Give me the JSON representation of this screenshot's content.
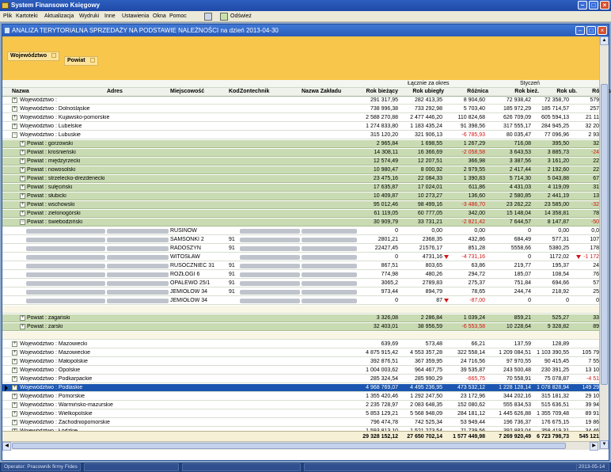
{
  "app": {
    "title": "System Finansowo Księgowy"
  },
  "menu": [
    "Plik",
    "Kartoteki",
    "Aktualizacja",
    "Wydruki",
    "Inne",
    "Ustawienia",
    "Okna",
    "Pomoc"
  ],
  "toolbar": {
    "refresh_label": "Odśwież"
  },
  "report": {
    "title": "ANALIZA TERYTORIALNA SPRZEDAŻY NA PODSTAWIE NALEŻNOŚCI na dzień 2013-04-30"
  },
  "grouping": {
    "chip1": "Województwo",
    "chip2": "Powiat"
  },
  "headers": {
    "band1": "Łącznie za okres",
    "band2": "Styczeń",
    "cols": [
      "Nazwa",
      "Adres",
      "Miejscowość",
      "Kod",
      "Zontechnik",
      "Nazwa Zakładu",
      "Rok bieżący",
      "Rok ubiegły",
      "Różnica",
      "Rok bież.",
      "Rok ub.",
      "Różnica"
    ]
  },
  "rows": [
    {
      "type": "w",
      "name": "Województwo :",
      "v": [
        "291 317,95",
        "282 413,35",
        "8 904,60",
        "72 938,42",
        "72 358,70",
        "579"
      ]
    },
    {
      "type": "w",
      "name": "Województwo : Dolnośląskie",
      "v": [
        "738 996,38",
        "733 292,98",
        "5 703,40",
        "185 972,29",
        "185 714,57",
        "257"
      ]
    },
    {
      "type": "w",
      "name": "Województwo : Kujawsko-pomorskie",
      "v": [
        "2 588 270,88",
        "2 477 446,20",
        "110 824,68",
        "626 709,09",
        "605 594,13",
        "21 11"
      ]
    },
    {
      "type": "w",
      "name": "Województwo : Lubelskie",
      "v": [
        "1 274 833,80",
        "1 183 435,24",
        "91 398,56",
        "317 555,17",
        "284 945,25",
        "32 20"
      ]
    },
    {
      "type": "w",
      "name": "Województwo : Lubuskie",
      "expanded": true,
      "v": [
        "315 120,20",
        "321 906,13",
        "-6 785,93",
        "80 035,47",
        "77 096,96",
        "2 93"
      ]
    },
    {
      "type": "p",
      "name": "Powiat : gorzowski",
      "v": [
        "2 965,84",
        "1 698,55",
        "1 267,29",
        "716,08",
        "395,50",
        "32"
      ]
    },
    {
      "type": "p",
      "name": "Powiat : krośnieński",
      "v": [
        "14 308,11",
        "16 366,69",
        "-2 058,58",
        "3 643,53",
        "3 885,73",
        "-24"
      ]
    },
    {
      "type": "p",
      "name": "Powiat : międzyrzecki",
      "v": [
        "12 574,49",
        "12 207,51",
        "366,98",
        "3 387,56",
        "3 161,20",
        "22"
      ]
    },
    {
      "type": "p",
      "name": "Powiat : nowosolski",
      "v": [
        "10 980,47",
        "8 000,92",
        "2 979,55",
        "2 417,44",
        "2 192,60",
        "22"
      ]
    },
    {
      "type": "p",
      "name": "Powiat : strzelecko-drezdenecki",
      "v": [
        "23 475,16",
        "22 084,33",
        "1 390,83",
        "5 714,30",
        "5 043,88",
        "67"
      ]
    },
    {
      "type": "p",
      "name": "Powiat : sulęciński",
      "v": [
        "17 635,87",
        "17 024,01",
        "611,86",
        "4 431,03",
        "4 119,09",
        "31"
      ]
    },
    {
      "type": "p",
      "name": "Powiat : słubicki",
      "v": [
        "10 409,87",
        "10 273,27",
        "136,60",
        "2 580,85",
        "2 441,19",
        "13"
      ]
    },
    {
      "type": "p",
      "name": "Powiat : wschowski",
      "v": [
        "95 012,46",
        "98 499,16",
        "-3 486,70",
        "23 262,22",
        "23 585,00",
        "-32"
      ]
    },
    {
      "type": "p",
      "name": "Powiat : zielonogórski",
      "v": [
        "61 119,05",
        "60 777,05",
        "342,00",
        "15 148,04",
        "14 358,81",
        "78"
      ]
    },
    {
      "type": "p",
      "name": "Powiat : świebodziński",
      "expanded": true,
      "v": [
        "30 909,79",
        "33 731,21",
        "-2 821,42",
        "7 644,57",
        "8 147,87",
        "-50"
      ]
    },
    {
      "type": "d",
      "city": "RUSINÓW",
      "kod": "",
      "v": [
        "0",
        "0,00",
        "0,00",
        "0",
        "0,00",
        "0,0"
      ]
    },
    {
      "type": "d",
      "city": "SAMSONKI 2",
      "kod": "91",
      "v": [
        "2801,21",
        "2368,35",
        "432,86",
        "684,49",
        "577,31",
        "107"
      ]
    },
    {
      "type": "d",
      "city": "RADOSZYN",
      "kod": "91",
      "v": [
        "22427,45",
        "21576,17",
        "851,28",
        "5558,66",
        "5380,25",
        "178"
      ]
    },
    {
      "type": "d",
      "city": "WITOSŁAW",
      "kod": "",
      "v": [
        "0",
        "4731,16",
        "-4 731,16",
        "0",
        "1172,02",
        "-1 172"
      ],
      "tri": [
        7,
        10
      ]
    },
    {
      "type": "d",
      "city": "RUSOCZNIEC 31",
      "kod": "91",
      "v": [
        "867,51",
        "803,65",
        "63,86",
        "219,77",
        "195,37",
        "24"
      ]
    },
    {
      "type": "d",
      "city": "ROZŁOGI 6",
      "kod": "91",
      "v": [
        "774,98",
        "480,26",
        "294,72",
        "185,07",
        "108,54",
        "76"
      ]
    },
    {
      "type": "d",
      "city": "OPALEWO 25/1",
      "kod": "91",
      "v": [
        "3065,2",
        "2789,83",
        "275,37",
        "751,84",
        "694,66",
        "57"
      ]
    },
    {
      "type": "d",
      "city": "JEMIOŁÓW 34",
      "kod": "91",
      "v": [
        "973,44",
        "894,79",
        "78,65",
        "244,74",
        "218,92",
        "25"
      ]
    },
    {
      "type": "d",
      "city": "JEMIOŁÓW 34",
      "kod": "",
      "v": [
        "0",
        "87",
        "-87,00",
        "0",
        "0",
        "0"
      ],
      "tri": [
        7
      ]
    },
    {
      "type": "b"
    },
    {
      "type": "p",
      "name": "Powiat : żagański",
      "v": [
        "3 326,08",
        "2 286,84",
        "1 039,24",
        "859,21",
        "525,27",
        "33"
      ]
    },
    {
      "type": "p",
      "name": "Powiat : żarski",
      "v": [
        "32 403,01",
        "38 956,59",
        "-6 553,58",
        "10 228,64",
        "9 328,82",
        "89"
      ]
    },
    {
      "type": "b"
    },
    {
      "type": "w",
      "name": "Województwo : Mazowiecki",
      "v": [
        "639,69",
        "573,48",
        "66,21",
        "137,59",
        "128,89",
        ""
      ]
    },
    {
      "type": "w",
      "name": "Województwo : Mazowieckie",
      "v": [
        "4 875 915,42",
        "4 553 357,28",
        "322 558,14",
        "1 209 084,51",
        "1 103 390,55",
        "105 79"
      ]
    },
    {
      "type": "w",
      "name": "Województwo : Małopolskie",
      "v": [
        "392 876,51",
        "367 359,95",
        "24 716,56",
        "97 970,55",
        "90 415,45",
        "7 55"
      ]
    },
    {
      "type": "w",
      "name": "Województwo : Opolskie",
      "v": [
        "1 004 003,62",
        "964 467,75",
        "39 535,87",
        "243 500,48",
        "230 391,25",
        "13 10"
      ]
    },
    {
      "type": "w",
      "name": "Województwo : Podkarpackie",
      "v": [
        "285 324,54",
        "285 990,29",
        "-665,75",
        "70 558,91",
        "75 078,87",
        "-4 51"
      ]
    },
    {
      "type": "w",
      "name": "Województwo : Podlaskie",
      "sel": true,
      "v": [
        "4 968 769,07",
        "4 495 236,95",
        "473 532,12",
        "1 228 128,14",
        "1 078 828,94",
        "149 29"
      ]
    },
    {
      "type": "w",
      "name": "Województwo : Pomorskie",
      "v": [
        "1 355 420,46",
        "1 292 247,50",
        "23 172,96",
        "344 202,16",
        "315 181,32",
        "29 10"
      ]
    },
    {
      "type": "w",
      "name": "Województwo : Warmińsko-mazurskie",
      "v": [
        "2 235 728,97",
        "2 083 648,35",
        "152 080,62",
        "555 834,53",
        "515 636,51",
        "39 94"
      ]
    },
    {
      "type": "w",
      "name": "Województwo : Wielkopolskie",
      "v": [
        "5 853 129,21",
        "5 568 948,09",
        "284 181,12",
        "1 445 626,88",
        "1 355 709,48",
        "89 91"
      ]
    },
    {
      "type": "w",
      "name": "Województwo : Zachodniopomorskie",
      "v": [
        "796 474,78",
        "742 525,34",
        "53 949,44",
        "196 736,37",
        "176 675,15",
        "19 86"
      ]
    },
    {
      "type": "w",
      "name": "Województwo : Łódzkie",
      "v": [
        "1 593 813,10",
        "1 521 273,54",
        "71 739,56",
        "392 883,04",
        "358 419,31",
        "34 46"
      ]
    }
  ],
  "totals": [
    "29 328 152,12",
    "27 650 702,14",
    "1 577 449,98",
    "7 269 920,49",
    "6 723 798,73",
    "545 121"
  ],
  "status": {
    "operator": "Operator: Pracownik firmy Fides",
    "date": "2013-05-14"
  }
}
